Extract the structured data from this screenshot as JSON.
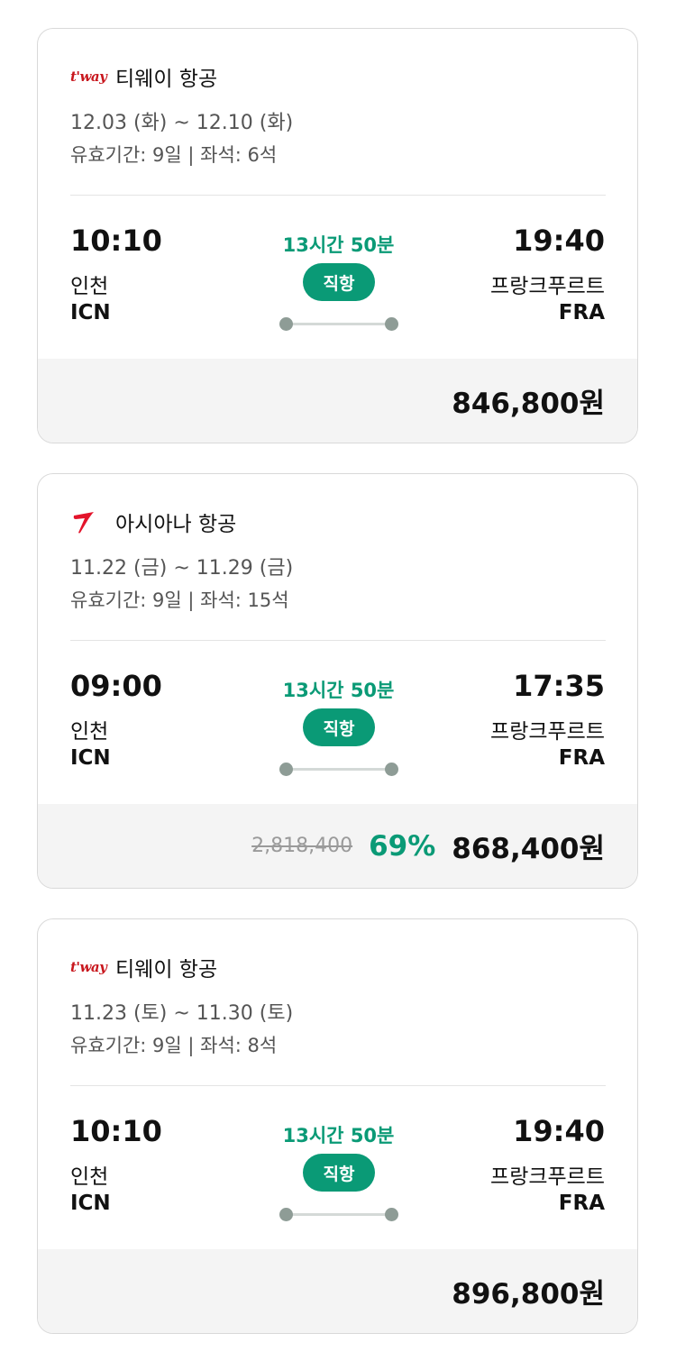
{
  "flights": [
    {
      "airline": {
        "name": "티웨이 항공",
        "logo_text": "t'way",
        "logo_icon": "tway-logo-icon"
      },
      "dates": "12.03 (화) ~ 12.10 (화)",
      "meta": "유효기간: 9일 | 좌석: 6석",
      "departure": {
        "time": "10:10",
        "city": "인천",
        "code": "ICN"
      },
      "arrival": {
        "time": "19:40",
        "city": "프랑크푸르트",
        "code": "FRA"
      },
      "duration": "13시간 50분",
      "direct_label": "직항",
      "price": "846,800원"
    },
    {
      "airline": {
        "name": "아시아나 항공",
        "logo_icon": "asiana-wing-logo-icon"
      },
      "dates": "11.22 (금) ~ 11.29 (금)",
      "meta": "유효기간: 9일 | 좌석: 15석",
      "departure": {
        "time": "09:00",
        "city": "인천",
        "code": "ICN"
      },
      "arrival": {
        "time": "17:35",
        "city": "프랑크푸르트",
        "code": "FRA"
      },
      "duration": "13시간 50분",
      "direct_label": "직항",
      "original_price": "2,818,400",
      "discount": "69%",
      "price": "868,400원"
    },
    {
      "airline": {
        "name": "티웨이 항공",
        "logo_text": "t'way",
        "logo_icon": "tway-logo-icon"
      },
      "dates": "11.23 (토) ~ 11.30 (토)",
      "meta": "유효기간: 9일 | 좌석: 8석",
      "departure": {
        "time": "10:10",
        "city": "인천",
        "code": "ICN"
      },
      "arrival": {
        "time": "19:40",
        "city": "프랑크푸르트",
        "code": "FRA"
      },
      "duration": "13시간 50분",
      "direct_label": "직항",
      "price": "896,800원"
    }
  ],
  "colors": {
    "accent_green": "#0a9a76",
    "tway_red": "#c8161d",
    "asiana_red": "#e3142b",
    "price_bar_bg": "#f4f4f4"
  }
}
